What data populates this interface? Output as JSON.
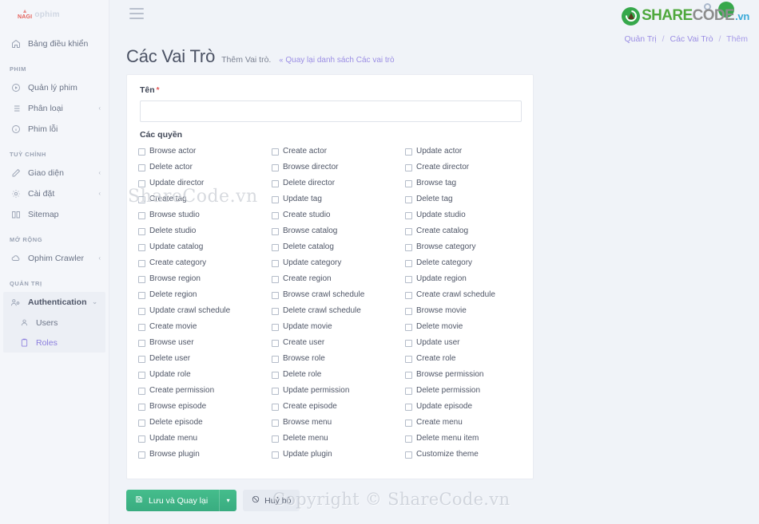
{
  "brand": {
    "logo_mark": "NAGI",
    "logo_text": "ophim"
  },
  "topbar": {
    "menu_icon": "hamburger-icon"
  },
  "site_logo": {
    "share": "SHARE",
    "code": "CODE",
    "vn": ".vn"
  },
  "breadcrumb": {
    "items": [
      "Quản Trị",
      "Các Vai Trò",
      "Thêm"
    ],
    "separator": "/"
  },
  "sidebar": {
    "dashboard": {
      "label": "Bảng điều khiển",
      "icon": "home-icon"
    },
    "sections": [
      {
        "label": "PHIM",
        "items": [
          {
            "label": "Quản lý phim",
            "icon": "play-circle-icon",
            "caret": ""
          },
          {
            "label": "Phân loại",
            "icon": "list-icon",
            "caret": "‹"
          },
          {
            "label": "Phim lỗi",
            "icon": "info-circle-icon",
            "caret": ""
          }
        ]
      },
      {
        "label": "TUỲ CHỈNH",
        "items": [
          {
            "label": "Giao diện",
            "icon": "pencil-icon",
            "caret": "‹"
          },
          {
            "label": "Cài đặt",
            "icon": "gear-icon",
            "caret": "‹"
          },
          {
            "label": "Sitemap",
            "icon": "book-icon",
            "caret": ""
          }
        ]
      },
      {
        "label": "MỞ RỘNG",
        "items": [
          {
            "label": "Ophim Crawler",
            "icon": "cloud-icon",
            "caret": "‹"
          }
        ]
      }
    ],
    "admin_section": {
      "label": "QUẢN TRỊ",
      "group": {
        "label": "Authentication",
        "icon": "users-cog-icon",
        "caret": "⌄"
      },
      "children": [
        {
          "label": "Users",
          "icon": "user-icon",
          "active": false
        },
        {
          "label": "Roles",
          "icon": "clipboard-icon",
          "active": true
        }
      ]
    }
  },
  "page": {
    "title": "Các Vai Trò",
    "subtitle": "Thêm Vai trò.",
    "back_link": "Quay lại danh sách Các vai trò",
    "back_chevron": "«"
  },
  "form": {
    "name_label": "Tên",
    "required_mark": "*",
    "name_value": "",
    "name_placeholder": "",
    "permissions_label": "Các quyền",
    "permissions": [
      "Browse actor",
      "Create actor",
      "Update actor",
      "Delete actor",
      "Browse director",
      "Create director",
      "Update director",
      "Delete director",
      "Browse tag",
      "Create tag",
      "Update tag",
      "Delete tag",
      "Browse studio",
      "Create studio",
      "Update studio",
      "Delete studio",
      "Browse catalog",
      "Create catalog",
      "Update catalog",
      "Delete catalog",
      "Browse category",
      "Create category",
      "Update category",
      "Delete category",
      "Browse region",
      "Create region",
      "Update region",
      "Delete region",
      "Browse crawl schedule",
      "Create crawl schedule",
      "Update crawl schedule",
      "Delete crawl schedule",
      "Browse movie",
      "Create movie",
      "Update movie",
      "Delete movie",
      "Browse user",
      "Create user",
      "Update user",
      "Delete user",
      "Browse role",
      "Create role",
      "Update role",
      "Delete role",
      "Browse permission",
      "Create permission",
      "Update permission",
      "Delete permission",
      "Browse episode",
      "Create episode",
      "Update episode",
      "Delete episode",
      "Browse menu",
      "Create menu",
      "Update menu",
      "Delete menu",
      "Delete menu item",
      "Browse plugin",
      "Update plugin",
      "Customize theme"
    ]
  },
  "actions": {
    "save_label": "Lưu và Quay lại",
    "save_icon": "save-icon",
    "save_caret": "▾",
    "cancel_label": "Huỷ bỏ",
    "cancel_icon": "ban-icon"
  },
  "watermarks": {
    "middle": "ShareCode.vn",
    "bottom": "Copyright © ShareCode.vn"
  },
  "colors": {
    "accent_purple": "#9b8ee4",
    "save_green": "#3fb488",
    "required_red": "#e25656",
    "page_bg": "#f0f3f8",
    "sidebar_bg": "#f4f6fa"
  }
}
